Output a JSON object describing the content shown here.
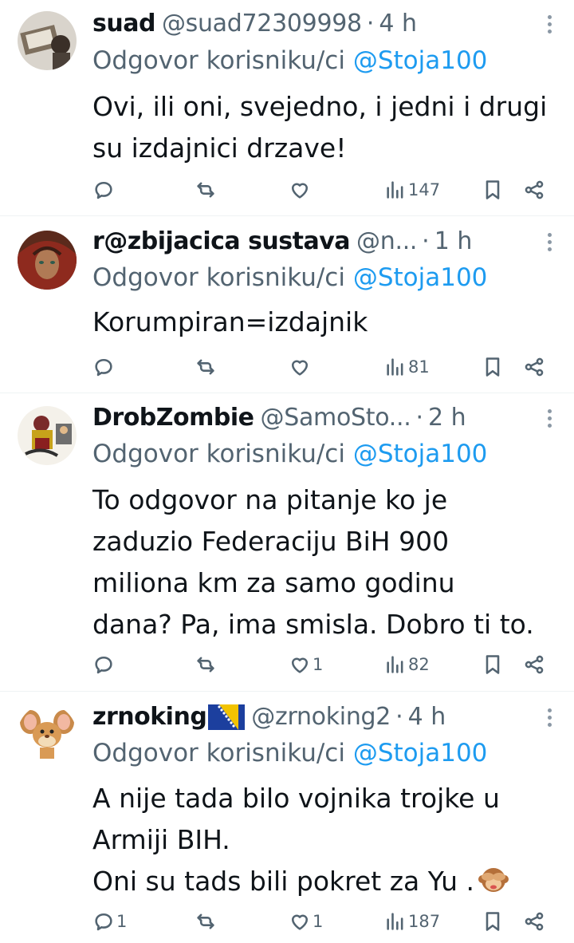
{
  "reply_prefix": "Odgovor korisniku/ci",
  "reply_mention": "@Stoja100",
  "separator": "·",
  "tweets": [
    {
      "name": "suad",
      "handle": "@suad72309998",
      "time": "4 h",
      "body": [
        "Ovi, ili oni, svejedno, i jedni i drugi",
        "su izdajnici drzave!"
      ],
      "replies": "",
      "reposts": "",
      "likes": "",
      "views": "147"
    },
    {
      "name": "r@zbijacica sustava",
      "handle": "@n...",
      "time": "1 h",
      "body": [
        "Korumpiran=izdajnik"
      ],
      "replies": "",
      "reposts": "",
      "likes": "",
      "views": "81"
    },
    {
      "name": "DrobZombie",
      "handle": "@SamoSto...",
      "time": "2 h",
      "body": [
        "To odgovor na pitanje ko je",
        "zaduzio Federaciju BiH 900",
        "miliona km za samo godinu",
        "dana? Pa, ima smisla. Dobro ti to."
      ],
      "replies": "",
      "reposts": "",
      "likes": "1",
      "views": "82"
    },
    {
      "name": "zrnoking",
      "name_flag": "bosnia-flag",
      "handle": "@zrnoking2",
      "time": "4 h",
      "body": [
        "A nije tada bilo vojnika trojke u",
        "Armiji BIH.",
        "Oni su tads bili pokret za Yu ."
      ],
      "body_emoji": "see-no-evil-monkey",
      "replies": "1",
      "reposts": "",
      "likes": "1",
      "views": "187"
    }
  ],
  "icons": [
    "reply-icon",
    "repost-icon",
    "like-icon",
    "views-icon",
    "bookmark-icon",
    "share-icon",
    "more-icon"
  ],
  "colors": {
    "text": "#0f1419",
    "muted": "#536471",
    "link": "#1d9bf0",
    "divider": "#eff3f4"
  }
}
